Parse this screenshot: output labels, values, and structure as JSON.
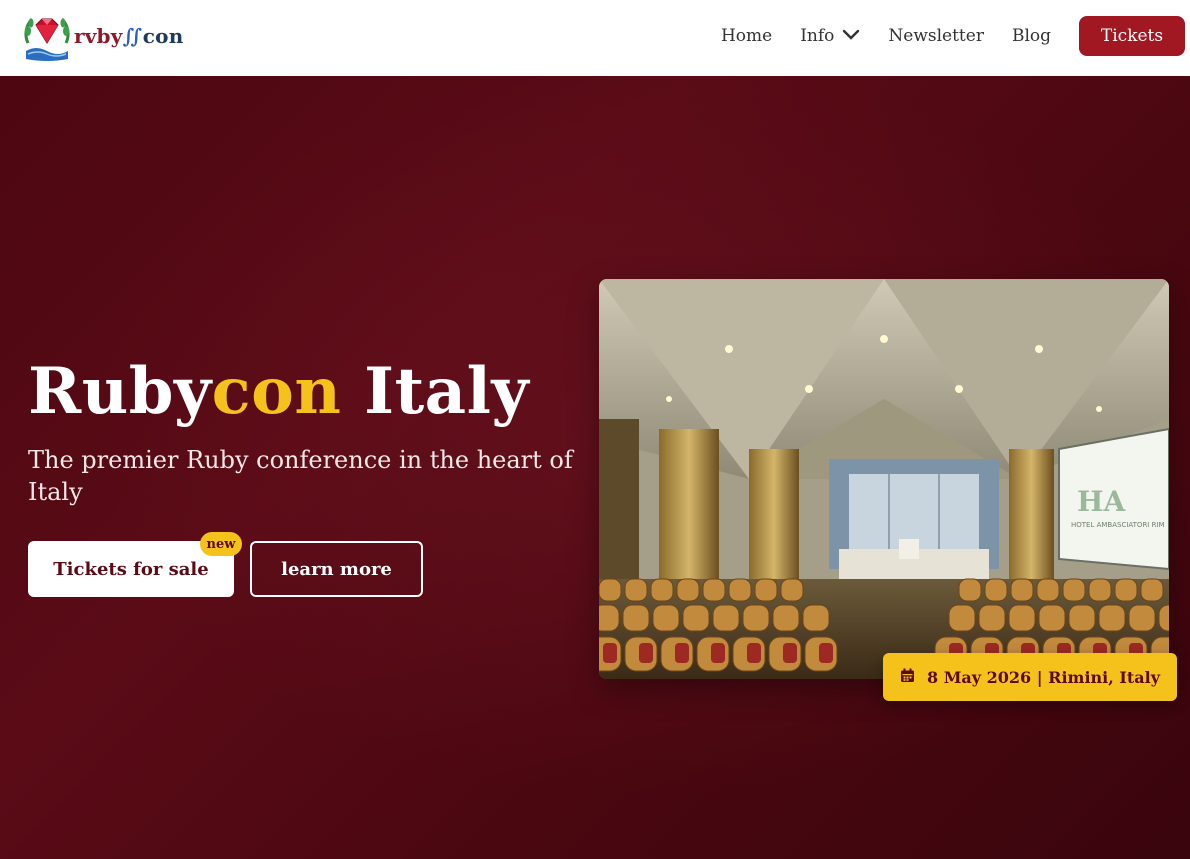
{
  "header": {
    "logo": {
      "part1": "rvby",
      "part2": "∬",
      "part3": "con"
    },
    "nav": [
      {
        "label": "Home"
      },
      {
        "label": "Info",
        "has_dropdown": true
      },
      {
        "label": "Newsletter"
      },
      {
        "label": "Blog"
      }
    ],
    "tickets_button": "Tickets"
  },
  "hero": {
    "title_part1": "Ruby",
    "title_part2": "con",
    "title_part3": " Italy",
    "subtitle": "The premier Ruby conference in the heart of Italy",
    "primary_button": "Tickets for sale",
    "badge": "new",
    "secondary_button": "learn more",
    "photo_sign": "HOTEL AMBASCIATORI RIM",
    "date_badge": "8 May 2026 | Rimini, Italy"
  },
  "colors": {
    "brand_red": "#a11722",
    "hero_bg": "#4d0711",
    "accent_yellow": "#f4c21a"
  },
  "icons": [
    "ruby-logo-icon",
    "chevron-down-icon",
    "calendar-icon"
  ]
}
